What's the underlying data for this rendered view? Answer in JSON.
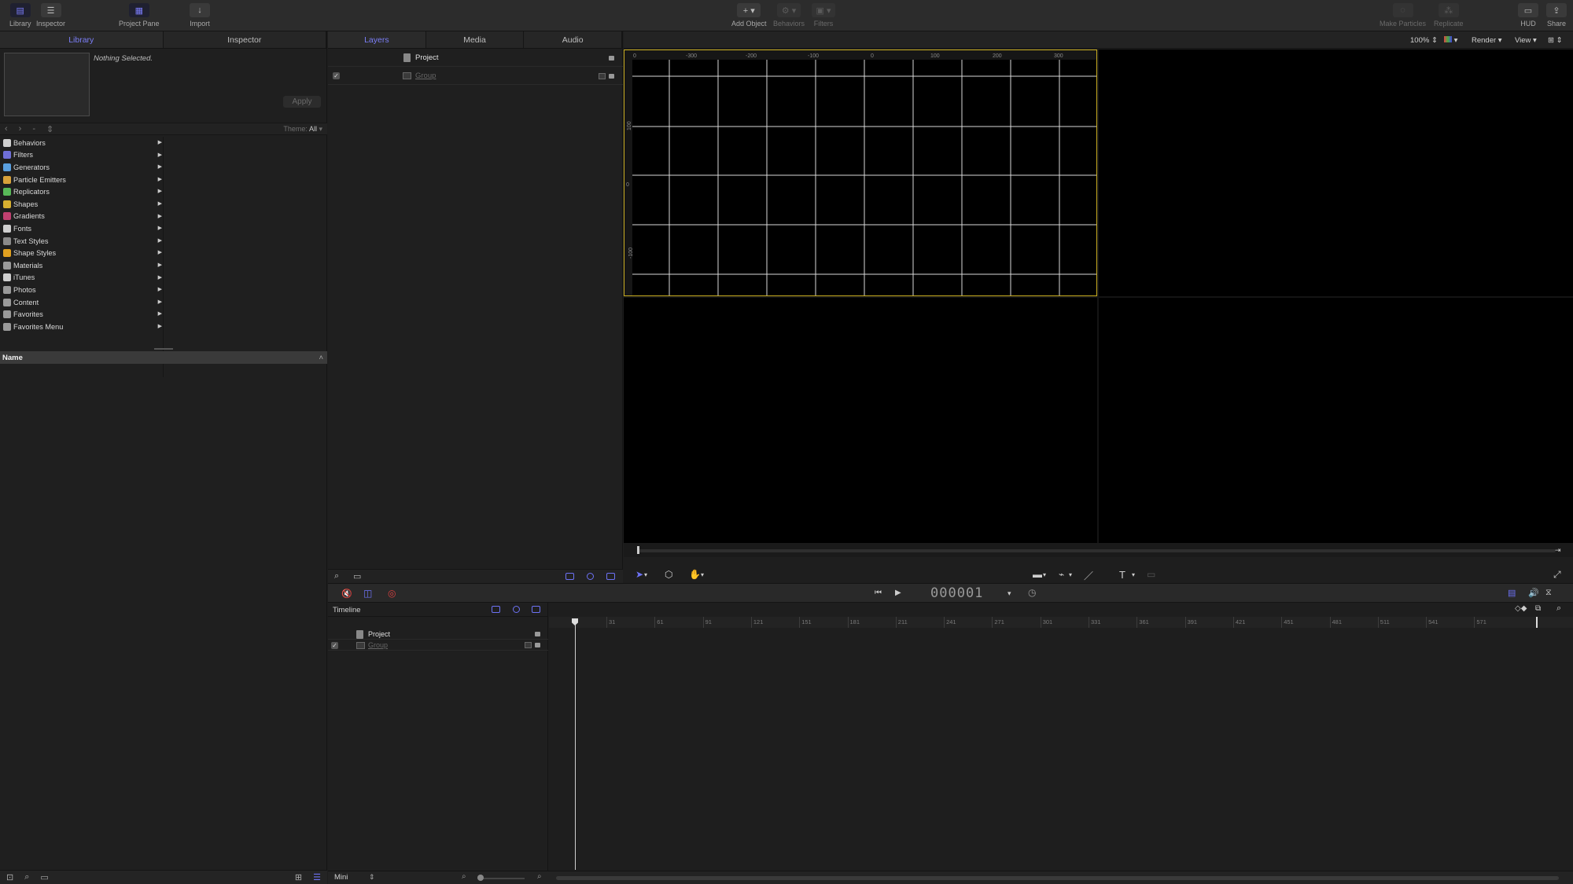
{
  "toolbar": {
    "library": "Library",
    "inspector": "Inspector",
    "project_pane": "Project Pane",
    "import": "Import",
    "add_object": "Add Object",
    "behaviors": "Behaviors",
    "filters": "Filters",
    "make_particles": "Make Particles",
    "replicate": "Replicate",
    "hud": "HUD",
    "share": "Share"
  },
  "left_panel": {
    "tabs": [
      "Library",
      "Inspector"
    ],
    "nothing_selected": "Nothing Selected.",
    "apply": "Apply",
    "theme_label": "Theme:",
    "theme_value": "All",
    "categories": [
      {
        "label": "Behaviors",
        "icon": "gear-icon",
        "color": "#cfcfcf"
      },
      {
        "label": "Filters",
        "icon": "filter-icon",
        "color": "#6f6fd8"
      },
      {
        "label": "Generators",
        "icon": "generator-icon",
        "color": "#5aa0e0"
      },
      {
        "label": "Particle Emitters",
        "icon": "particle-icon",
        "color": "#d8a23a"
      },
      {
        "label": "Replicators",
        "icon": "replicator-icon",
        "color": "#58b858"
      },
      {
        "label": "Shapes",
        "icon": "shape-icon",
        "color": "#d8b030"
      },
      {
        "label": "Gradients",
        "icon": "gradient-icon",
        "color": "#c04070"
      },
      {
        "label": "Fonts",
        "icon": "font-icon",
        "color": "#cfcfcf"
      },
      {
        "label": "Text Styles",
        "icon": "text-style-icon",
        "color": "#8a8a8a"
      },
      {
        "label": "Shape Styles",
        "icon": "shape-style-icon",
        "color": "#e0a020"
      },
      {
        "label": "Materials",
        "icon": "material-icon",
        "color": "#9a9a9a"
      },
      {
        "label": "iTunes",
        "icon": "music-icon",
        "color": "#cfcfcf"
      },
      {
        "label": "Photos",
        "icon": "photo-icon",
        "color": "#9a9a9a"
      },
      {
        "label": "Content",
        "icon": "folder-icon",
        "color": "#9a9a9a"
      },
      {
        "label": "Favorites",
        "icon": "favorites-icon",
        "color": "#9a9a9a"
      },
      {
        "label": "Favorites Menu",
        "icon": "favorites-menu-icon",
        "color": "#9a9a9a"
      }
    ],
    "name_header": "Name"
  },
  "layers_panel": {
    "tabs": [
      "Layers",
      "Media",
      "Audio"
    ],
    "project": "Project",
    "group": "Group"
  },
  "canvas": {
    "zoom": "100%",
    "render": "Render",
    "view": "View",
    "ruler_labels": [
      "0",
      "-300",
      "-200",
      "-100",
      "0",
      "100",
      "200",
      "300"
    ],
    "left_ruler_labels": [
      "100",
      "0",
      "-100"
    ]
  },
  "timeline": {
    "label": "Timeline",
    "project": "Project",
    "group": "Group",
    "timecode": "000001",
    "ruler_labels": [
      "31",
      "61",
      "91",
      "121",
      "151",
      "181",
      "211",
      "241",
      "271",
      "301",
      "331",
      "361",
      "391",
      "421",
      "451",
      "481",
      "511",
      "541",
      "571"
    ],
    "mini": "Mini"
  }
}
